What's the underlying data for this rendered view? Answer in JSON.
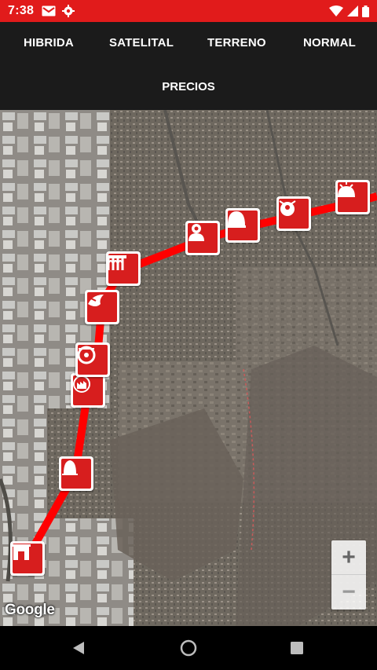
{
  "status_bar": {
    "time": "7:38",
    "left_icons": [
      "gmail-icon",
      "settings-icon"
    ],
    "right_icons": [
      "wifi-icon",
      "signal-icon",
      "battery-icon"
    ]
  },
  "toolbar": {
    "tabs": [
      {
        "label": "HIBRIDA"
      },
      {
        "label": "SATELITAL"
      },
      {
        "label": "TERRENO"
      },
      {
        "label": "NORMAL"
      },
      {
        "label": "PRECIOS"
      }
    ]
  },
  "map": {
    "route_color": "#ff0000",
    "marker_color": "#d71e1e",
    "markers": [
      {
        "icon": "building-gate-icon"
      },
      {
        "icon": "bell-icon"
      },
      {
        "icon": "factory-icon"
      },
      {
        "icon": "wheel-icon"
      },
      {
        "icon": "bird-icon"
      },
      {
        "icon": "aqueduct-icon"
      },
      {
        "icon": "bust-icon"
      },
      {
        "icon": "dome-icon"
      },
      {
        "icon": "figure-icon"
      },
      {
        "icon": "sun-icon"
      }
    ],
    "zoom_in_label": "+",
    "zoom_out_label": "−",
    "attribution": "Google"
  },
  "nav_bar": {
    "buttons": [
      "back-icon",
      "home-icon",
      "recents-icon"
    ]
  }
}
